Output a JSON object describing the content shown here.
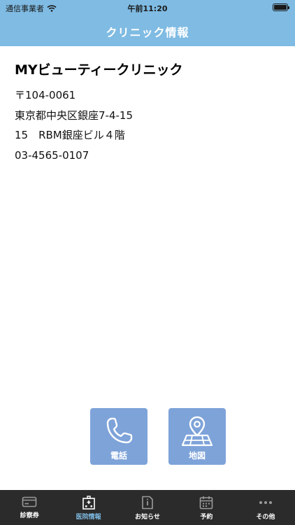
{
  "status_bar": {
    "carrier": "通信事業者",
    "time": "午前11:20"
  },
  "header": {
    "title": "クリニック情報"
  },
  "clinic": {
    "name": "MYビューティークリニック",
    "postal": "〒104-0061",
    "address1": "東京都中央区銀座7-4-15",
    "address2": "15　RBM銀座ビル４階",
    "phone": "03-4565-0107"
  },
  "actions": {
    "call_label": "電話",
    "map_label": "地図"
  },
  "tabs": [
    {
      "label": "診察券",
      "icon": "card-icon"
    },
    {
      "label": "医院情報",
      "icon": "hospital-icon"
    },
    {
      "label": "お知らせ",
      "icon": "notice-icon"
    },
    {
      "label": "予約",
      "icon": "calendar-icon"
    },
    {
      "label": "その他",
      "icon": "more-icon"
    }
  ],
  "colors": {
    "header": "#7fbbe3",
    "button": "#7da3d9",
    "tabbar": "#2b2b2b",
    "tab_active": "#7fbbe3"
  }
}
